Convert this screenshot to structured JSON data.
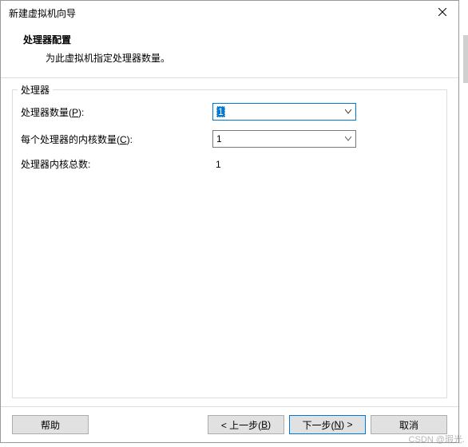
{
  "titlebar": {
    "title": "新建虚拟机向导"
  },
  "header": {
    "title": "处理器配置",
    "subtitle": "为此虚拟机指定处理器数量。"
  },
  "group": {
    "label": "处理器",
    "rows": {
      "processors": {
        "label_pre": "处理器数量(",
        "label_key": "P",
        "label_post": "):",
        "value": "1"
      },
      "cores": {
        "label_pre": "每个处理器的内核数量(",
        "label_key": "C",
        "label_post": "):",
        "value": "1"
      },
      "total": {
        "label": "处理器内核总数:",
        "value": "1"
      }
    }
  },
  "footer": {
    "help": "帮助",
    "back_pre": "< 上一步(",
    "back_key": "B",
    "back_post": ")",
    "next_pre": "下一步(",
    "next_key": "N",
    "next_post": ") >",
    "cancel": "取消"
  },
  "watermark": "CSDN @瑕光."
}
